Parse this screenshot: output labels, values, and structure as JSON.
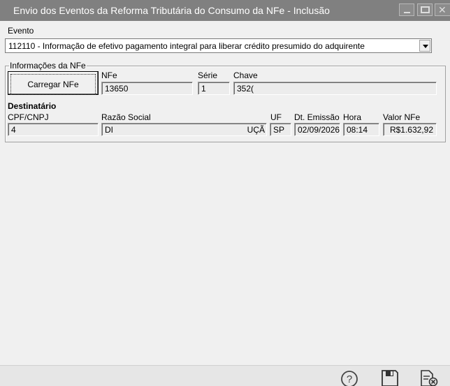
{
  "window": {
    "title": "Envio dos Eventos da Reforma Tributária do Consumo da NFe - Inclusão"
  },
  "evento": {
    "label": "Evento",
    "selected": "112110 - Informação de efetivo pagamento integral para liberar crédito presumido do adquirente"
  },
  "nfe_group": {
    "legend": "Informações da NFe",
    "load_button": "Carregar NFe",
    "nfe_label": "NFe",
    "nfe_value": "13650",
    "serie_label": "Série",
    "serie_value": "1",
    "chave_label": "Chave",
    "chave_value": "352("
  },
  "destinatario": {
    "heading": "Destinatário",
    "cpf_label": "CPF/CNPJ",
    "cpf_value": "4",
    "razao_label": "Razão Social",
    "razao_value_left": "DI",
    "razao_value_right": "UÇÃ",
    "uf_label": "UF",
    "uf_value": "SP",
    "emissao_label": "Dt. Emissão",
    "emissao_value": "02/09/2026",
    "hora_label": "Hora",
    "hora_value": "08:14",
    "valor_label": "Valor NFe",
    "valor_value": "R$1.632,92"
  },
  "toolbar": {
    "icons": [
      "help-icon",
      "save-icon",
      "cancel-icon"
    ]
  }
}
